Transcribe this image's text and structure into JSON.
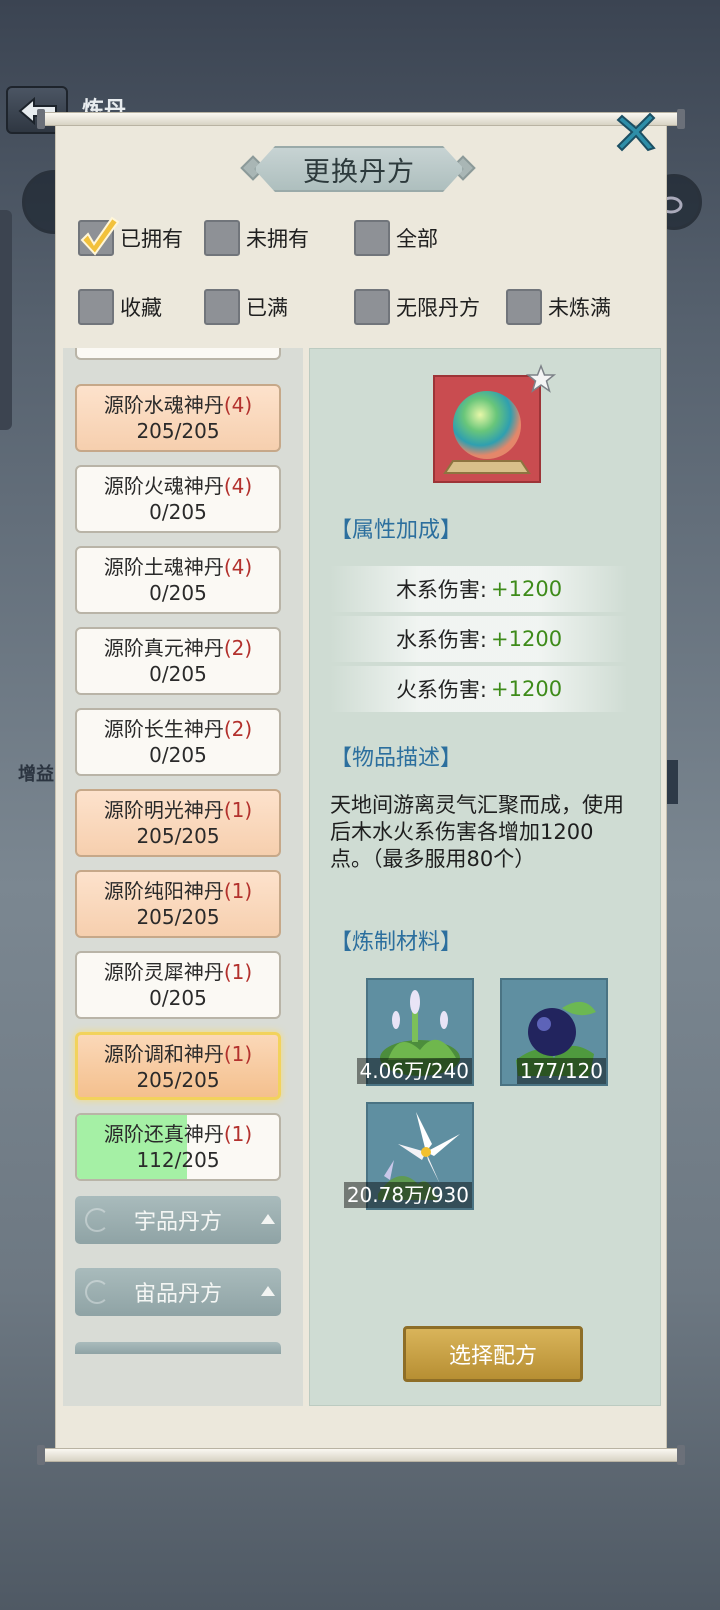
{
  "background": {
    "title": "炼丹",
    "side_label": "增益"
  },
  "panel": {
    "title": "更换丹方"
  },
  "filters": [
    {
      "label": "已拥有",
      "checked": true
    },
    {
      "label": "未拥有",
      "checked": false
    },
    {
      "label": "全部",
      "checked": false
    },
    {
      "label": "收藏",
      "checked": false
    },
    {
      "label": "已满",
      "checked": false
    },
    {
      "label": "无限丹方",
      "checked": false
    },
    {
      "label": "未炼满",
      "checked": false
    }
  ],
  "recipes": [
    {
      "name": "源阶水魂神丹",
      "tier": "(4)",
      "progress": "205/205",
      "state": "full"
    },
    {
      "name": "源阶火魂神丹",
      "tier": "(4)",
      "progress": "0/205",
      "state": "empty"
    },
    {
      "name": "源阶土魂神丹",
      "tier": "(4)",
      "progress": "0/205",
      "state": "empty"
    },
    {
      "name": "源阶真元神丹",
      "tier": "(2)",
      "progress": "0/205",
      "state": "empty"
    },
    {
      "name": "源阶长生神丹",
      "tier": "(2)",
      "progress": "0/205",
      "state": "empty"
    },
    {
      "name": "源阶明光神丹",
      "tier": "(1)",
      "progress": "205/205",
      "state": "full"
    },
    {
      "name": "源阶纯阳神丹",
      "tier": "(1)",
      "progress": "205/205",
      "state": "full"
    },
    {
      "name": "源阶灵犀神丹",
      "tier": "(1)",
      "progress": "0/205",
      "state": "empty"
    },
    {
      "name": "源阶调和神丹",
      "tier": "(1)",
      "progress": "205/205",
      "state": "selected"
    },
    {
      "name": "源阶还真神丹",
      "tier": "(1)",
      "progress": "112/205",
      "state": "partial",
      "fill_fraction": 0.546
    }
  ],
  "categories": [
    {
      "label": "宇品丹方"
    },
    {
      "label": "宙品丹方"
    }
  ],
  "detail": {
    "attributes_title": "【属性加成】",
    "attributes": [
      {
        "name": "木系伤害:",
        "value": "+1200"
      },
      {
        "name": "水系伤害:",
        "value": "+1200"
      },
      {
        "name": "火系伤害:",
        "value": "+1200"
      }
    ],
    "description_title": "【物品描述】",
    "description": "天地间游离灵气汇聚而成，使用后木水火系伤害各增加1200点。（最多服用80个）",
    "materials_title": "【炼制材料】",
    "materials": [
      {
        "icon": "herb-flower-icon",
        "count": "4.06万/240"
      },
      {
        "icon": "blue-berry-icon",
        "count": "177/120"
      },
      {
        "icon": "white-lily-icon",
        "count": "20.78万/930"
      }
    ],
    "select_button": "选择配方"
  },
  "colors": {
    "accent_blue": "#2c6f9e",
    "bonus_green": "#3e8b1a",
    "tier_red": "#b3312d",
    "button_gold": "#c9a245"
  }
}
